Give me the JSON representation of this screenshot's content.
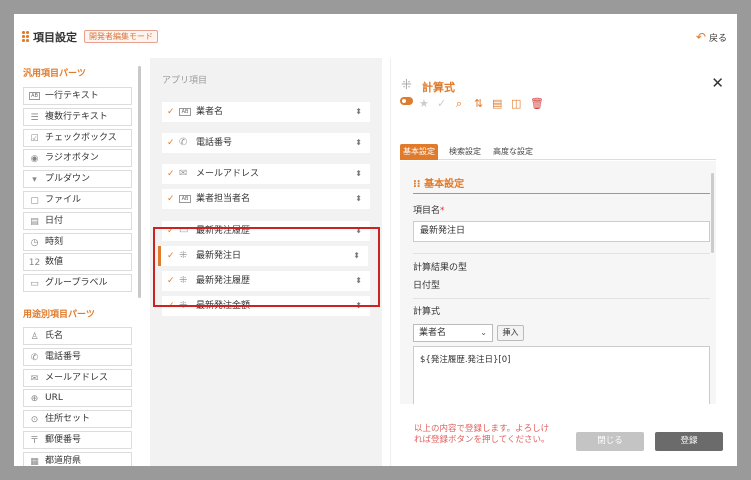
{
  "header": {
    "title": "項目設定",
    "mode_badge": "開発者編集モード",
    "back_label": "戻る"
  },
  "left_panel": {
    "general_heading": "汎用項目パーツ",
    "general_items": [
      {
        "label": "一行テキスト",
        "icon": "text-field-icon",
        "glyph": "AB"
      },
      {
        "label": "複数行テキスト",
        "icon": "multiline-text-icon",
        "glyph": "☰"
      },
      {
        "label": "チェックボックス",
        "icon": "checkbox-icon",
        "glyph": "☑"
      },
      {
        "label": "ラジオボタン",
        "icon": "radio-icon",
        "glyph": "◉"
      },
      {
        "label": "プルダウン",
        "icon": "dropdown-icon",
        "glyph": "▾"
      },
      {
        "label": "ファイル",
        "icon": "file-icon",
        "glyph": "▢"
      },
      {
        "label": "日付",
        "icon": "calendar-icon",
        "glyph": "▤"
      },
      {
        "label": "時刻",
        "icon": "clock-icon",
        "glyph": "◷"
      },
      {
        "label": "数値",
        "icon": "number-icon",
        "glyph": "12"
      },
      {
        "label": "グループラベル",
        "icon": "folder-icon",
        "glyph": "▭"
      }
    ],
    "specific_heading": "用途別項目パーツ",
    "specific_items": [
      {
        "label": "氏名",
        "icon": "person-icon",
        "glyph": "♙"
      },
      {
        "label": "電話番号",
        "icon": "phone-icon",
        "glyph": "✆"
      },
      {
        "label": "メールアドレス",
        "icon": "mail-icon",
        "glyph": "✉"
      },
      {
        "label": "URL",
        "icon": "globe-icon",
        "glyph": "⊕"
      },
      {
        "label": "住所セット",
        "icon": "location-icon",
        "glyph": "⊙"
      },
      {
        "label": "郵便番号",
        "icon": "postal-icon",
        "glyph": "〒"
      },
      {
        "label": "都道府県",
        "icon": "prefecture-icon",
        "glyph": "▦"
      }
    ]
  },
  "middle_panel": {
    "heading": "アプリ項目",
    "items": [
      {
        "label": "業者名",
        "icon": "text-field-icon",
        "glyph": "AB"
      },
      {
        "label": "電話番号",
        "icon": "phone-icon",
        "glyph": "✆"
      },
      {
        "label": "メールアドレス",
        "icon": "mail-icon",
        "glyph": "✉"
      },
      {
        "label": "業者担当者名",
        "icon": "text-field-icon",
        "glyph": "AB"
      },
      {
        "label": "最新発注履歴",
        "icon": "folder-icon",
        "glyph": "▭"
      },
      {
        "label": "最新発注日",
        "icon": "calc-icon",
        "glyph": "⁜"
      },
      {
        "label": "最新発注履歴",
        "icon": "calc-icon",
        "glyph": "⁜"
      },
      {
        "label": "最新発注金額",
        "icon": "calc-icon",
        "glyph": "⁜"
      }
    ]
  },
  "right_panel": {
    "title": "計算式",
    "tabs": [
      "基本設定",
      "検索設定",
      "高度な設定"
    ],
    "section_title": "基本設定",
    "field_name_label": "項目名",
    "required_mark": "*",
    "field_name_value": "最新発注日",
    "result_type_label": "計算結果の型",
    "result_type_value": "日付型",
    "formula_label": "計算式",
    "formula_select": "業者名",
    "insert_label": "挿入",
    "formula_value": "${発注履歴.発注日}[0]",
    "note": "以上の内容で登録します。よろしければ登録ボタンを押してください。",
    "close_label": "閉じる",
    "register_label": "登録"
  },
  "colors": {
    "accent": "#e07b2c",
    "highlight": "#cc2222"
  }
}
